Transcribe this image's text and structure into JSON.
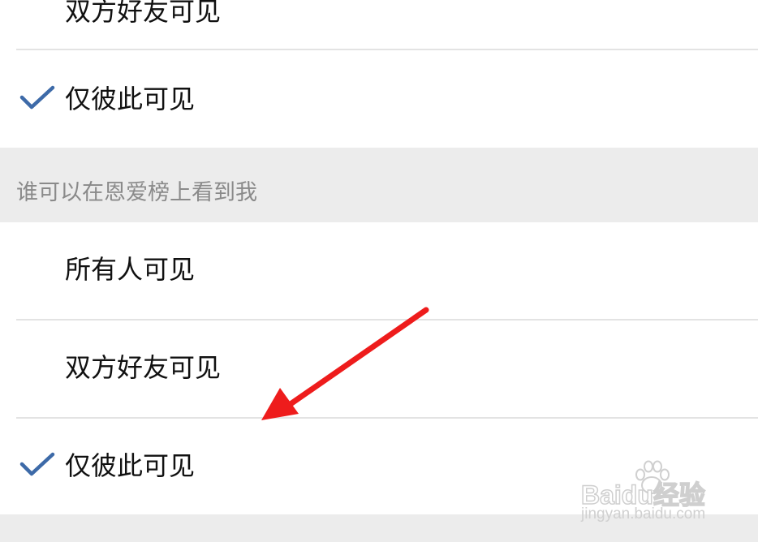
{
  "group1": {
    "items": [
      {
        "label": "双方好友可见",
        "checked": false
      },
      {
        "label": "仅彼此可见",
        "checked": true
      }
    ]
  },
  "section2": {
    "title": "谁可以在恩爱榜上看到我",
    "items": [
      {
        "label": "所有人可见",
        "checked": false
      },
      {
        "label": "双方好友可见",
        "checked": false
      },
      {
        "label": "仅彼此可见",
        "checked": true
      }
    ]
  },
  "colors": {
    "check": "#3d6aa8",
    "arrow": "#ee1c1c",
    "section_bg": "#ececec",
    "divider": "#e3e3e3"
  },
  "icons": {
    "check": "checkmark-icon",
    "arrow": "red-arrow-annotation"
  },
  "watermark": {
    "brand": "Baidu经验",
    "url": "jingyan.baidu.com"
  }
}
